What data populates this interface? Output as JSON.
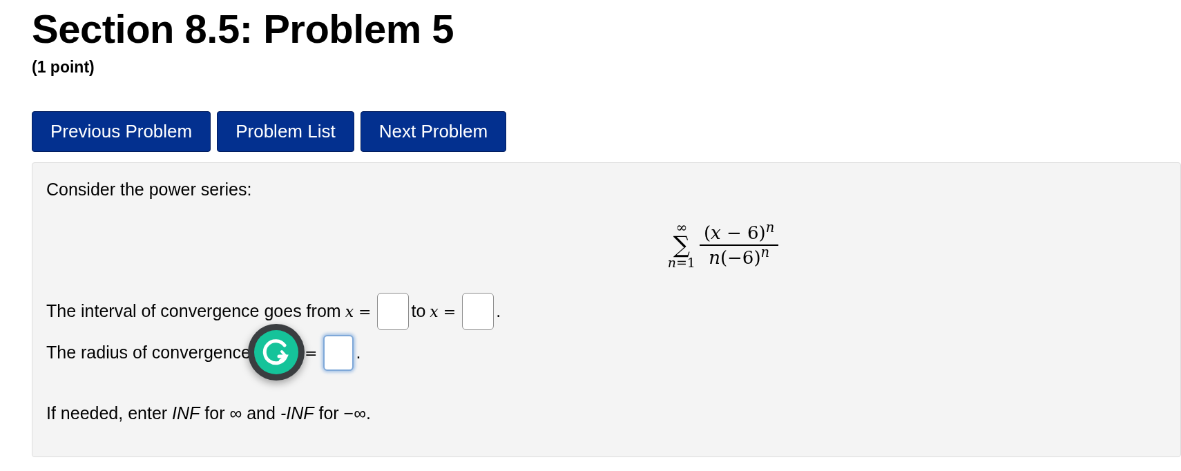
{
  "title": "Section 8.5: Problem 5",
  "points": "(1 point)",
  "nav_buttons": [
    "Previous Problem",
    "Problem List",
    "Next Problem"
  ],
  "problem": {
    "intro": "Consider the power series:",
    "series": {
      "upper": "∞",
      "symbol": "∑",
      "lower": "*n*=1",
      "numerator": "(*x* − 6)$^{n}$",
      "denominator": "*n*(−6)$^{n}$"
    },
    "answer_lines": [
      {
        "segments": [
          {
            "kind": "text",
            "text": "The interval of convergence goes from"
          },
          {
            "kind": "math",
            "text": "*x* ="
          },
          {
            "kind": "field",
            "focused": false
          },
          {
            "kind": "text",
            "text": "to"
          },
          {
            "kind": "math",
            "text": "*x* ="
          },
          {
            "kind": "field",
            "focused": false
          },
          {
            "kind": "text",
            "text": "."
          }
        ]
      },
      {
        "segments": [
          {
            "kind": "text",
            "text": "The radius of convergence"
          },
          {
            "kind": "overlay"
          },
          {
            "kind": "math",
            "text": "="
          },
          {
            "kind": "field",
            "focused": true
          },
          {
            "kind": "text",
            "text": "."
          }
        ]
      }
    ],
    "hint": "If needed, enter *INF* for ∞ and *-INF* for −∞."
  }
}
